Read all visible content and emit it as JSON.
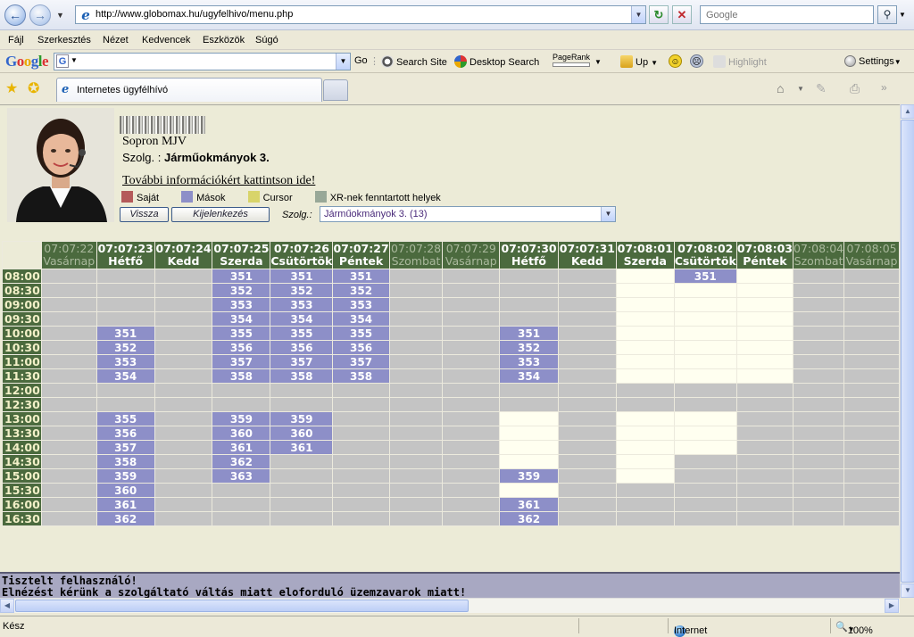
{
  "browser": {
    "url": "http://www.globomax.hu/ugyfelhivo/menu.php",
    "search_placeholder": "Google",
    "menu": [
      "Fájl",
      "Szerkesztés",
      "Nézet",
      "Kedvencek",
      "Eszközök",
      "Súgó"
    ],
    "google_toolbar": {
      "logo": "Google",
      "go": "Go",
      "search_site": "Search Site",
      "desktop_search": "Desktop Search",
      "pagerank": "PageRank",
      "up": "Up",
      "highlight": "Highlight",
      "settings": "Settings"
    },
    "tab_title": "Internetes ügyfélhívó",
    "status_text": "Kész",
    "zone": "Internet",
    "zoom": "100%"
  },
  "page": {
    "city": "Sopron MJV",
    "service_prefix": "Szolg. :",
    "service_name": "Járműokmányok 3.",
    "info_link": "További információkért kattintson ide!",
    "legend": [
      {
        "label": "Saját",
        "color": "#b45a5a"
      },
      {
        "label": "Mások",
        "color": "#8d8fc8"
      },
      {
        "label": "Cursor",
        "color": "#d8d46a"
      },
      {
        "label": "XR-nek fenntartott helyek",
        "color": "#98a898"
      }
    ],
    "back_button": "Vissza",
    "logout_button": "Kijelenkezés",
    "select_label": "Szolg.:",
    "select_value": "Járműokmányok 3. (13)",
    "footer_line1": "Tisztelt felhasználó!",
    "footer_line2": "Elnézést kérünk a szolgáltató váltás miatt eloforduló üzemzavarok miatt!"
  },
  "schedule": {
    "columns": [
      {
        "time": "07:07:22",
        "day": "Vasárnap",
        "active": false
      },
      {
        "time": "07:07:23",
        "day": "Hétfő",
        "active": true
      },
      {
        "time": "07:07:24",
        "day": "Kedd",
        "active": true
      },
      {
        "time": "07:07:25",
        "day": "Szerda",
        "active": true
      },
      {
        "time": "07:07:26",
        "day": "Csütörtök",
        "active": true
      },
      {
        "time": "07:07:27",
        "day": "Péntek",
        "active": true
      },
      {
        "time": "07:07:28",
        "day": "Szombat",
        "active": false
      },
      {
        "time": "07:07:29",
        "day": "Vasárnap",
        "active": false
      },
      {
        "time": "07:07:30",
        "day": "Hétfő",
        "active": true
      },
      {
        "time": "07:07:31",
        "day": "Kedd",
        "active": true
      },
      {
        "time": "07:08:01",
        "day": "Szerda",
        "active": true
      },
      {
        "time": "07:08:02",
        "day": "Csütörtök",
        "active": true
      },
      {
        "time": "07:08:03",
        "day": "Péntek",
        "active": true
      },
      {
        "time": "07:08:04",
        "day": "Szombat",
        "active": false
      },
      {
        "time": "07:08:05",
        "day": "Vasárnap",
        "active": false
      }
    ],
    "rows": [
      {
        "time": "08:00",
        "cells": [
          "g",
          "g",
          "g",
          "351",
          "351",
          "351",
          "g",
          "g",
          "g",
          "g",
          "y",
          "351",
          "y",
          "g",
          "g"
        ]
      },
      {
        "time": "08:30",
        "cells": [
          "g",
          "g",
          "g",
          "352",
          "352",
          "352",
          "g",
          "g",
          "g",
          "g",
          "y",
          "y",
          "y",
          "g",
          "g"
        ]
      },
      {
        "time": "09:00",
        "cells": [
          "g",
          "g",
          "g",
          "353",
          "353",
          "353",
          "g",
          "g",
          "g",
          "g",
          "y",
          "y",
          "y",
          "g",
          "g"
        ]
      },
      {
        "time": "09:30",
        "cells": [
          "g",
          "g",
          "g",
          "354",
          "354",
          "354",
          "g",
          "g",
          "g",
          "g",
          "y",
          "y",
          "y",
          "g",
          "g"
        ]
      },
      {
        "time": "10:00",
        "cells": [
          "g",
          "351",
          "g",
          "355",
          "355",
          "355",
          "g",
          "g",
          "351",
          "g",
          "y",
          "y",
          "y",
          "g",
          "g"
        ]
      },
      {
        "time": "10:30",
        "cells": [
          "g",
          "352",
          "g",
          "356",
          "356",
          "356",
          "g",
          "g",
          "352",
          "g",
          "y",
          "y",
          "y",
          "g",
          "g"
        ]
      },
      {
        "time": "11:00",
        "cells": [
          "g",
          "353",
          "g",
          "357",
          "357",
          "357",
          "g",
          "g",
          "353",
          "g",
          "y",
          "y",
          "y",
          "g",
          "g"
        ]
      },
      {
        "time": "11:30",
        "cells": [
          "g",
          "354",
          "g",
          "358",
          "358",
          "358",
          "g",
          "g",
          "354",
          "g",
          "y",
          "y",
          "y",
          "g",
          "g"
        ]
      },
      {
        "time": "12:00",
        "cells": [
          "g",
          "g",
          "g",
          "g",
          "g",
          "g",
          "g",
          "g",
          "g",
          "g",
          "g",
          "g",
          "g",
          "g",
          "g"
        ]
      },
      {
        "time": "12:30",
        "cells": [
          "g",
          "g",
          "g",
          "g",
          "g",
          "g",
          "g",
          "g",
          "g",
          "g",
          "g",
          "g",
          "g",
          "g",
          "g"
        ]
      },
      {
        "time": "13:00",
        "cells": [
          "g",
          "355",
          "g",
          "359",
          "359",
          "g",
          "g",
          "g",
          "y",
          "g",
          "y",
          "y",
          "g",
          "g",
          "g"
        ]
      },
      {
        "time": "13:30",
        "cells": [
          "g",
          "356",
          "g",
          "360",
          "360",
          "g",
          "g",
          "g",
          "y",
          "g",
          "y",
          "y",
          "g",
          "g",
          "g"
        ]
      },
      {
        "time": "14:00",
        "cells": [
          "g",
          "357",
          "g",
          "361",
          "361",
          "g",
          "g",
          "g",
          "y",
          "g",
          "y",
          "y",
          "g",
          "g",
          "g"
        ]
      },
      {
        "time": "14:30",
        "cells": [
          "g",
          "358",
          "g",
          "362",
          "g",
          "g",
          "g",
          "g",
          "y",
          "g",
          "y",
          "g",
          "g",
          "g",
          "g"
        ]
      },
      {
        "time": "15:00",
        "cells": [
          "g",
          "359",
          "g",
          "363",
          "g",
          "g",
          "g",
          "g",
          "359",
          "g",
          "y",
          "g",
          "g",
          "g",
          "g"
        ]
      },
      {
        "time": "15:30",
        "cells": [
          "g",
          "360",
          "g",
          "g",
          "g",
          "g",
          "g",
          "g",
          "y",
          "g",
          "g",
          "g",
          "g",
          "g",
          "g"
        ]
      },
      {
        "time": "16:00",
        "cells": [
          "g",
          "361",
          "g",
          "g",
          "g",
          "g",
          "g",
          "g",
          "361",
          "g",
          "g",
          "g",
          "g",
          "g",
          "g"
        ]
      },
      {
        "time": "16:30",
        "cells": [
          "g",
          "362",
          "g",
          "g",
          "g",
          "g",
          "g",
          "g",
          "362",
          "g",
          "g",
          "g",
          "g",
          "g",
          "g"
        ]
      }
    ]
  }
}
